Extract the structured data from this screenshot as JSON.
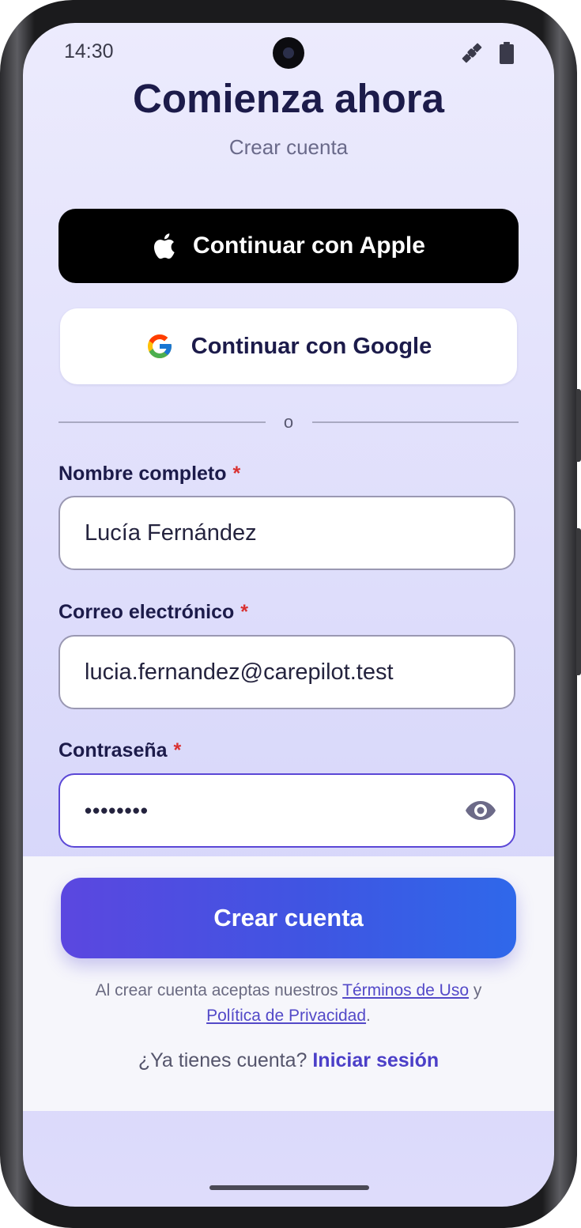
{
  "status": {
    "time": "14:30",
    "icons": [
      "satellite-icon",
      "battery-icon"
    ]
  },
  "header": {
    "title": "Comienza ahora",
    "subtitle": "Crear cuenta"
  },
  "social": {
    "apple_label": "Continuar con Apple",
    "google_label": "Continuar con Google",
    "divider_text": "o"
  },
  "form": {
    "name": {
      "label": "Nombre completo",
      "required_mark": "*",
      "value": "Lucía Fernández"
    },
    "email": {
      "label": "Correo electrónico",
      "required_mark": "*",
      "value": "lucia.fernandez@carepilot.test"
    },
    "password": {
      "label": "Contraseña",
      "required_mark": "*",
      "value": "••••••••"
    }
  },
  "actions": {
    "create_label": "Crear cuenta",
    "terms_prefix": "Al crear cuenta aceptas nuestros",
    "terms_link": "Términos de Uso",
    "terms_and": "y",
    "privacy_link": "Política de Privacidad",
    "terms_end": ".",
    "have_account": "¿Ya tienes cuenta?",
    "login_link": "Iniciar sesión"
  },
  "colors": {
    "accent": "#4b3fc8",
    "button_gradient_start": "#5b47e0",
    "button_gradient_end": "#2f68ea",
    "required": "#d93030",
    "title": "#1c1b4a"
  }
}
